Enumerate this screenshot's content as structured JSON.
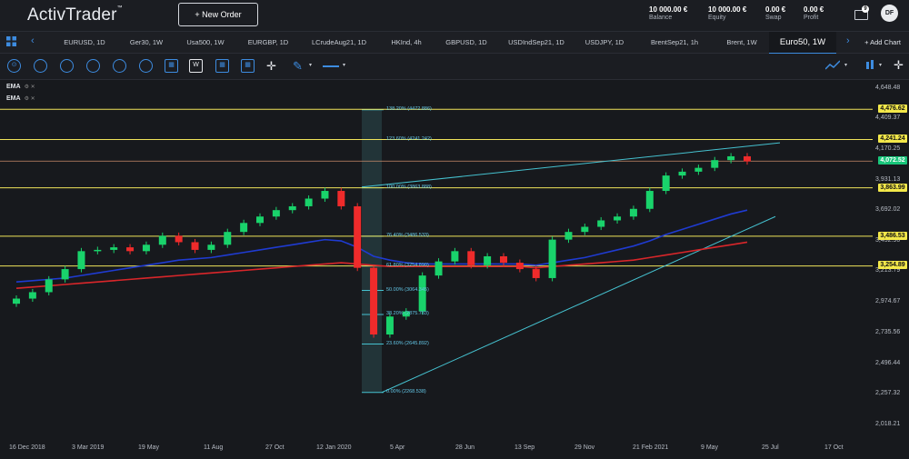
{
  "app": {
    "logo": "ActivTrader",
    "logo_tm": "™",
    "new_order_label": "+ New Order"
  },
  "metrics": [
    {
      "value": "10 000.00 €",
      "label": "Balance"
    },
    {
      "value": "10 000.00 €",
      "label": "Equity"
    },
    {
      "value": "0.00 €",
      "label": "Swap"
    },
    {
      "value": "0.00 €",
      "label": "Profit"
    }
  ],
  "notifications_count": "9",
  "user_initials": "DF",
  "tabs": [
    "EURUSD, 1D",
    "Ger30, 1W",
    "Usa500, 1W",
    "EURGBP, 1D",
    "LCrudeAug21, 1D",
    "HKInd, 4h",
    "GBPUSD, 1D",
    "USDIndSep21, 1D",
    "USDJPY, 1D",
    "BrentSep21, 1h",
    "Brent, 1W",
    "Euro50, 1W"
  ],
  "active_tab": "Euro50, 1W",
  "add_chart_label": "+ Add Chart",
  "indicators": [
    "EMA",
    "EMA"
  ],
  "y_ticks": [
    "4,648.48",
    "4,409.37",
    "4,170.25",
    "3,931.13",
    "3,692.02",
    "3,452.90",
    "3,213.79",
    "2,974.67",
    "2,735.56",
    "2,496.44",
    "2,257.32",
    "2,018.21"
  ],
  "price_badges": [
    {
      "label": "4,476.62",
      "color": "yellow"
    },
    {
      "label": "4,241.24",
      "color": "yellow"
    },
    {
      "label": "4,072.52",
      "color": "green"
    },
    {
      "label": "3,863.99",
      "color": "yellow"
    },
    {
      "label": "3,486.53",
      "color": "yellow"
    },
    {
      "label": "3,254.89",
      "color": "yellow"
    }
  ],
  "x_ticks": [
    "16 Dec 2018",
    "3 Mar 2019",
    "19 May",
    "11 Aug",
    "27 Oct",
    "12 Jan 2020",
    "5 Apr",
    "28 Jun",
    "13 Sep",
    "29 Nov",
    "21 Feb 2021",
    "9 May",
    "25 Jul",
    "17 Oct"
  ],
  "fib_levels": [
    "138.20% (4472.886)",
    "123.60% (4241.242)",
    "100.00% (3863.888)",
    "76.40% (3486.533)",
    "61.80% (3254.890)",
    "50.00% (3064.345)",
    "38.20% (2875.783)",
    "23.60% (2645.892)",
    "0.00% (2268.538)"
  ],
  "colors": {
    "up": "#19d36b",
    "down": "#ef2b2b",
    "hline": "#f0e45a",
    "ema_fast": "#1f3bd1",
    "ema_slow": "#d9262a",
    "trend": "#45c1cf",
    "accent": "#3d8ce0"
  },
  "chart_data": {
    "type": "candlestick",
    "symbol": "Euro50",
    "timeframe": "1W",
    "x": [
      "2018-12-16",
      "2019-01-06",
      "2019-01-27",
      "2019-02-17",
      "2019-03-10",
      "2019-03-31",
      "2019-04-21",
      "2019-05-12",
      "2019-06-02",
      "2019-06-23",
      "2019-07-14",
      "2019-08-04",
      "2019-08-25",
      "2019-09-15",
      "2019-10-06",
      "2019-10-27",
      "2019-11-17",
      "2019-12-08",
      "2019-12-29",
      "2020-01-19",
      "2020-02-09",
      "2020-03-01",
      "2020-03-22",
      "2020-04-12",
      "2020-05-03",
      "2020-05-24",
      "2020-06-14",
      "2020-07-05",
      "2020-07-26",
      "2020-08-16",
      "2020-09-06",
      "2020-09-27",
      "2020-10-18",
      "2020-11-08",
      "2020-11-29",
      "2020-12-20",
      "2021-01-10",
      "2021-01-31",
      "2021-02-21",
      "2021-03-14",
      "2021-04-04",
      "2021-04-25",
      "2021-05-16",
      "2021-06-06",
      "2021-06-27",
      "2021-07-18"
    ],
    "close": [
      3000,
      3050,
      3150,
      3230,
      3370,
      3380,
      3400,
      3370,
      3420,
      3490,
      3440,
      3380,
      3420,
      3520,
      3590,
      3640,
      3690,
      3720,
      3780,
      3840,
      3720,
      3240,
      2720,
      2860,
      2900,
      3180,
      3290,
      3370,
      3260,
      3330,
      3280,
      3230,
      3160,
      3460,
      3520,
      3560,
      3610,
      3640,
      3700,
      3840,
      3960,
      3990,
      4020,
      4080,
      4110,
      4070
    ],
    "ylim": [
      2018.21,
      4648.48
    ],
    "horizontal_levels": [
      4476.62,
      4241.24,
      4072.52,
      3863.99,
      3486.53,
      3254.89
    ],
    "fibonacci": {
      "high": 3863.888,
      "low": 2268.538
    },
    "series": [
      {
        "name": "EMA",
        "values": [
          3130,
          3140,
          3150,
          3160,
          3180,
          3200,
          3220,
          3240,
          3260,
          3280,
          3300,
          3310,
          3320,
          3340,
          3360,
          3380,
          3400,
          3420,
          3440,
          3460,
          3450,
          3400,
          3330,
          3300,
          3280,
          3270,
          3270,
          3270,
          3270,
          3270,
          3270,
          3270,
          3260,
          3280,
          3300,
          3320,
          3350,
          3380,
          3410,
          3450,
          3500,
          3540,
          3580,
          3620,
          3660,
          3690
        ]
      },
      {
        "name": "EMA",
        "values": [
          3080,
          3090,
          3100,
          3110,
          3120,
          3130,
          3140,
          3150,
          3160,
          3170,
          3180,
          3190,
          3200,
          3210,
          3220,
          3230,
          3240,
          3250,
          3260,
          3270,
          3280,
          3270,
          3260,
          3250,
          3250,
          3250,
          3250,
          3250,
          3250,
          3250,
          3250,
          3250,
          3240,
          3250,
          3260,
          3270,
          3280,
          3290,
          3300,
          3320,
          3340,
          3360,
          3380,
          3400,
          3420,
          3440
        ]
      }
    ],
    "xlabel": "",
    "ylabel": ""
  }
}
